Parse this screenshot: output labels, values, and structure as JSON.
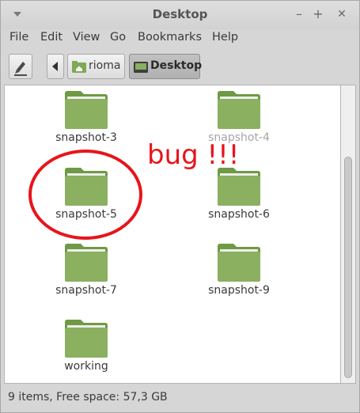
{
  "window": {
    "title": "Desktop",
    "controls": {
      "minimize": "–",
      "maximize": "+",
      "close": "✕"
    }
  },
  "menu": [
    "File",
    "Edit",
    "View",
    "Go",
    "Bookmarks",
    "Help"
  ],
  "toolbar": {
    "path": [
      {
        "label": "rioma",
        "icon": "home-folder-icon",
        "active": false
      },
      {
        "label": "Desktop",
        "icon": "desktop-icon",
        "active": true
      }
    ]
  },
  "files": [
    {
      "name": "snapshot-3",
      "dim": false
    },
    {
      "name": "snapshot-4",
      "dim": true
    },
    {
      "name": "snapshot-5",
      "dim": false
    },
    {
      "name": "snapshot-6",
      "dim": false
    },
    {
      "name": "snapshot-7",
      "dim": false
    },
    {
      "name": "snapshot-9",
      "dim": false
    },
    {
      "name": "working",
      "dim": false
    }
  ],
  "annotation": {
    "text": "bug !!!",
    "color": "#e8141b"
  },
  "status": {
    "text": "9 items, Free space: 57,3 GB"
  },
  "colors": {
    "folder": "#8ab060",
    "folder_dark": "#6f9a44",
    "accent_red": "#e8141b"
  }
}
